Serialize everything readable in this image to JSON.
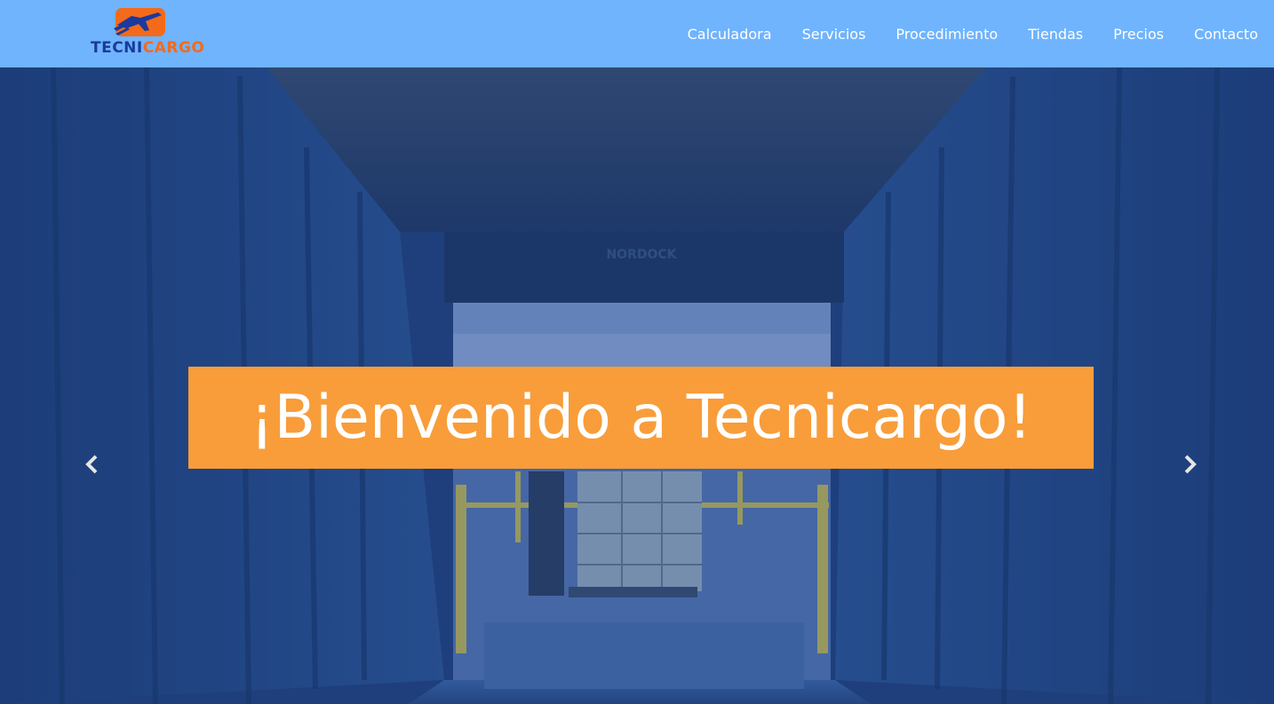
{
  "brand": {
    "name_part1": "TECNI",
    "name_part2": "CARGO",
    "color_primary": "#1b3a9e",
    "color_accent": "#f46a1a"
  },
  "nav": {
    "items": [
      {
        "label": "Calculadora"
      },
      {
        "label": "Servicios"
      },
      {
        "label": "Procedimiento"
      },
      {
        "label": "Tiendas"
      },
      {
        "label": "Precios"
      },
      {
        "label": "Contacto"
      }
    ],
    "background": "#6fb4fd"
  },
  "hero": {
    "title": "¡Bienvenido a Tecnicargo!",
    "title_box_color": "#f89d3a",
    "overlay_color": "#1d3e73",
    "image_sign_text": "NORDOCK",
    "prev_icon": "chevron-left-icon",
    "next_icon": "chevron-right-icon"
  }
}
